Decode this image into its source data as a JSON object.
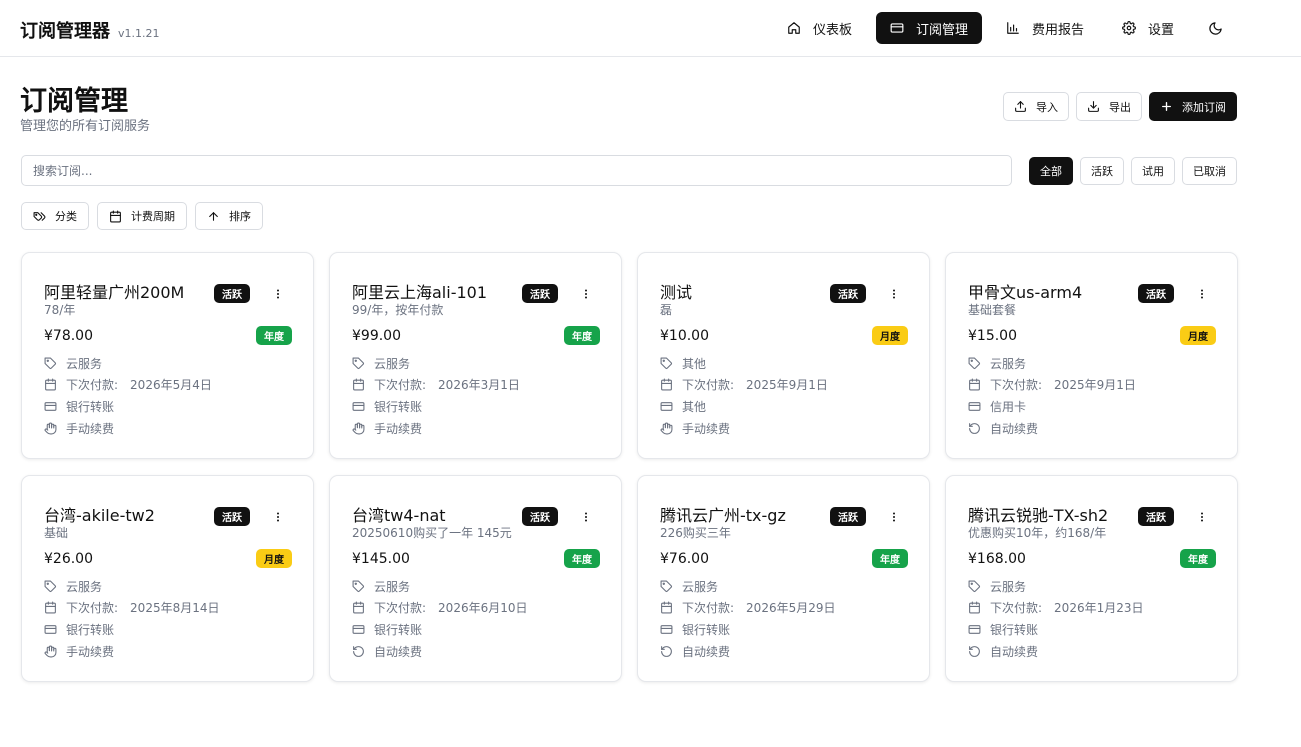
{
  "app": {
    "title": "订阅管理器",
    "version": "v1.1.21"
  },
  "nav": [
    {
      "label": "仪表板",
      "icon": "home-icon",
      "active": false
    },
    {
      "label": "订阅管理",
      "icon": "card-icon",
      "active": true
    },
    {
      "label": "费用报告",
      "icon": "chart-icon",
      "active": false
    },
    {
      "label": "设置",
      "icon": "gear-icon",
      "active": false
    }
  ],
  "page": {
    "title": "订阅管理",
    "subtitle": "管理您的所有订阅服务"
  },
  "actions": {
    "import_label": "导入",
    "export_label": "导出",
    "add_label": "添加订阅"
  },
  "search": {
    "placeholder": "搜索订阅...",
    "value": ""
  },
  "status_filters": [
    {
      "label": "全部",
      "active": true
    },
    {
      "label": "活跃",
      "active": false
    },
    {
      "label": "试用",
      "active": false
    },
    {
      "label": "已取消",
      "active": false
    }
  ],
  "sub_filters": {
    "category_label": "分类",
    "cycle_label": "计费周期",
    "sort_label": "排序"
  },
  "next_payment_label": "下次付款:",
  "subscriptions": [
    {
      "name": "阿里轻量广州200M",
      "desc": "78/年",
      "status": "活跃",
      "price": "¥78.00",
      "cycle": "年度",
      "cycle_type": "yearly",
      "category": "云服务",
      "next_payment": "2026年5月4日",
      "payment_method": "银行转账",
      "renewal": "手动续费",
      "renewal_type": "manual"
    },
    {
      "name": "阿里云上海ali-101",
      "desc": "99/年，按年付款",
      "status": "活跃",
      "price": "¥99.00",
      "cycle": "年度",
      "cycle_type": "yearly",
      "category": "云服务",
      "next_payment": "2026年3月1日",
      "payment_method": "银行转账",
      "renewal": "手动续费",
      "renewal_type": "manual"
    },
    {
      "name": "测试",
      "desc": "磊",
      "status": "活跃",
      "price": "¥10.00",
      "cycle": "月度",
      "cycle_type": "monthly",
      "category": "其他",
      "next_payment": "2025年9月1日",
      "payment_method": "其他",
      "renewal": "手动续费",
      "renewal_type": "manual"
    },
    {
      "name": "甲骨文us-arm4",
      "desc": "基础套餐",
      "status": "活跃",
      "price": "¥15.00",
      "cycle": "月度",
      "cycle_type": "monthly",
      "category": "云服务",
      "next_payment": "2025年9月1日",
      "payment_method": "信用卡",
      "renewal": "自动续费",
      "renewal_type": "auto"
    },
    {
      "name": "台湾-akile-tw2",
      "desc": "基础",
      "status": "活跃",
      "price": "¥26.00",
      "cycle": "月度",
      "cycle_type": "monthly",
      "category": "云服务",
      "next_payment": "2025年8月14日",
      "payment_method": "银行转账",
      "renewal": "手动续费",
      "renewal_type": "manual"
    },
    {
      "name": "台湾tw4-nat",
      "desc": "20250610购买了一年 145元",
      "status": "活跃",
      "price": "¥145.00",
      "cycle": "年度",
      "cycle_type": "yearly",
      "category": "云服务",
      "next_payment": "2026年6月10日",
      "payment_method": "银行转账",
      "renewal": "自动续费",
      "renewal_type": "auto"
    },
    {
      "name": "腾讯云广州-tx-gz",
      "desc": "226购买三年",
      "status": "活跃",
      "price": "¥76.00",
      "cycle": "年度",
      "cycle_type": "yearly",
      "category": "云服务",
      "next_payment": "2026年5月29日",
      "payment_method": "银行转账",
      "renewal": "自动续费",
      "renewal_type": "auto"
    },
    {
      "name": "腾讯云锐驰-TX-sh2",
      "desc": "优惠购买10年，约168/年",
      "status": "活跃",
      "price": "¥168.00",
      "cycle": "年度",
      "cycle_type": "yearly",
      "category": "云服务",
      "next_payment": "2026年1月23日",
      "payment_method": "银行转账",
      "renewal": "自动续费",
      "renewal_type": "auto"
    }
  ],
  "colors": {
    "accent": "#111111",
    "yearly": "#16a34a",
    "monthly": "#facc15",
    "muted": "#6b7280",
    "border": "#e5e7eb"
  }
}
